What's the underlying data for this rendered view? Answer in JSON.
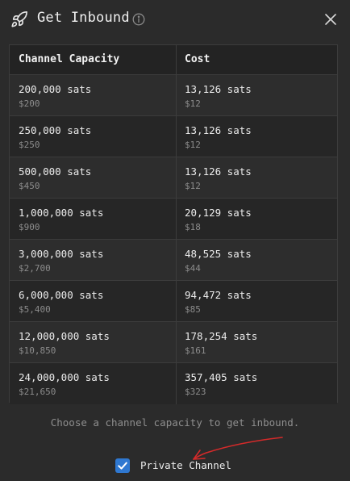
{
  "header": {
    "title": "Get Inbound",
    "icons": {
      "leading": "rocket-icon",
      "info": "info-icon",
      "close": "close-icon"
    }
  },
  "table": {
    "columns": [
      "Channel Capacity",
      "Cost"
    ],
    "rows": [
      {
        "capacity": "200,000 sats",
        "capacity_usd": "$200",
        "cost": "13,126 sats",
        "cost_usd": "$12"
      },
      {
        "capacity": "250,000 sats",
        "capacity_usd": "$250",
        "cost": "13,126 sats",
        "cost_usd": "$12"
      },
      {
        "capacity": "500,000 sats",
        "capacity_usd": "$450",
        "cost": "13,126 sats",
        "cost_usd": "$12"
      },
      {
        "capacity": "1,000,000 sats",
        "capacity_usd": "$900",
        "cost": "20,129 sats",
        "cost_usd": "$18"
      },
      {
        "capacity": "3,000,000 sats",
        "capacity_usd": "$2,700",
        "cost": "48,525 sats",
        "cost_usd": "$44"
      },
      {
        "capacity": "6,000,000 sats",
        "capacity_usd": "$5,400",
        "cost": "94,472 sats",
        "cost_usd": "$85"
      },
      {
        "capacity": "12,000,000 sats",
        "capacity_usd": "$10,850",
        "cost": "178,254 sats",
        "cost_usd": "$161"
      },
      {
        "capacity": "24,000,000 sats",
        "capacity_usd": "$21,650",
        "cost": "357,405 sats",
        "cost_usd": "$323"
      }
    ]
  },
  "footer": {
    "hint": "Choose a channel capacity to get inbound.",
    "private_channel_label": "Private Channel",
    "private_channel_checked": true
  },
  "colors": {
    "background": "#2b2b2b",
    "accent": "#2f78d1",
    "annotation": "#d42a2a"
  }
}
